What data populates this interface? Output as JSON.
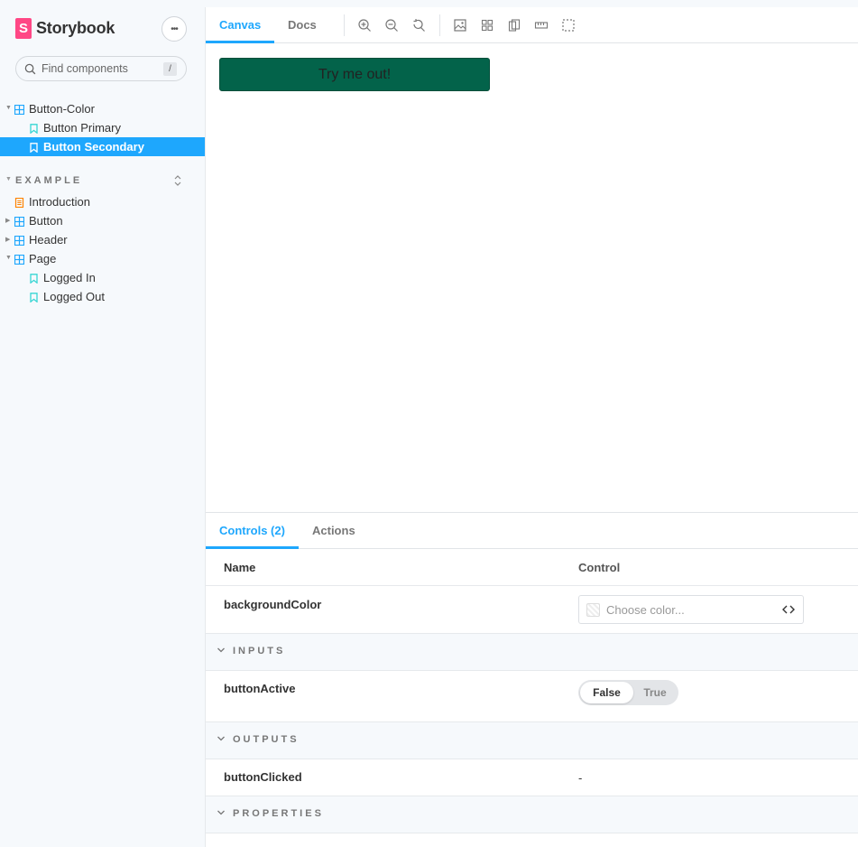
{
  "sidebar": {
    "brand": "Storybook",
    "logo_letter": "S",
    "menu_label": "•••",
    "search_placeholder": "Find components",
    "search_shortcut": "/",
    "top_items": [
      {
        "label": "Button-Color",
        "kind": "component"
      },
      {
        "label": "Button Primary",
        "kind": "story"
      },
      {
        "label": "Button Secondary",
        "kind": "story",
        "selected": true
      }
    ],
    "section_title": "EXAMPLE",
    "section_items": [
      {
        "label": "Introduction",
        "kind": "docs"
      },
      {
        "label": "Button",
        "kind": "component"
      },
      {
        "label": "Header",
        "kind": "component"
      },
      {
        "label": "Page",
        "kind": "component"
      },
      {
        "label": "Logged In",
        "kind": "story"
      },
      {
        "label": "Logged Out",
        "kind": "story"
      }
    ]
  },
  "toolbar": {
    "tabs": [
      "Canvas",
      "Docs"
    ],
    "active_tab": "Canvas",
    "tools": [
      "zoom-in-icon",
      "zoom-out-icon",
      "zoom-reset-icon",
      "background-icon",
      "grid-icon",
      "viewport-icon",
      "measure-icon",
      "outline-icon"
    ]
  },
  "preview": {
    "button_label": "Try me out!",
    "button_color": "#03634a"
  },
  "addons": {
    "tabs": [
      "Controls (2)",
      "Actions"
    ],
    "active_tab": "Controls (2)",
    "table": {
      "header_name": "Name",
      "header_control": "Control",
      "background_color": {
        "name": "backgroundColor",
        "placeholder": "Choose color..."
      },
      "inputs_title": "INPUTS",
      "button_active": {
        "name": "buttonActive",
        "option_false": "False",
        "option_true": "True",
        "selected": "False"
      },
      "outputs_title": "OUTPUTS",
      "button_clicked": {
        "name": "buttonClicked",
        "value": "-"
      },
      "properties_title": "PROPERTIES"
    }
  },
  "colors": {
    "accent": "#1ea7fd",
    "brand": "#ff4785",
    "story_icon": "#37d5d3",
    "component_icon": "#1ea7fd",
    "docs_icon": "#ff8300"
  }
}
